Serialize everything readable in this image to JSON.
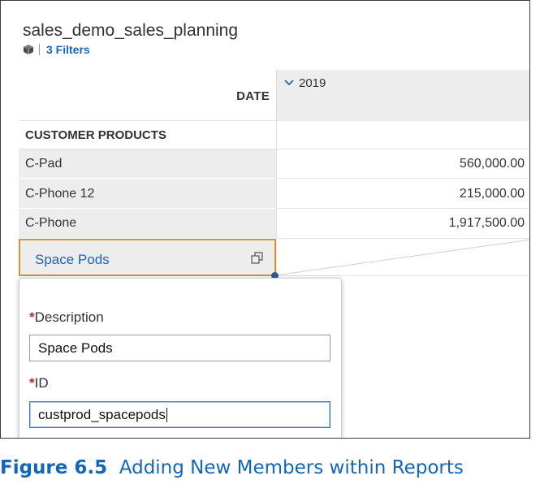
{
  "app": {
    "title": "sales_demo_sales_planning",
    "filters_label": "3 Filters",
    "filter_icon": "cube-icon"
  },
  "table": {
    "row_dimension_header": "DATE",
    "column_header": "2019",
    "column_header_icon": "chevron-down-icon",
    "section_header": "CUSTOMER PRODUCTS",
    "rows": [
      {
        "label": "C-Pad",
        "value": "560,000.00"
      },
      {
        "label": "C-Phone 12",
        "value": "215,000.00"
      },
      {
        "label": "C-Phone",
        "value": "1,917,500.00"
      }
    ],
    "new_member_label": "Space Pods",
    "new_member_icon": "open-external-icon"
  },
  "popup": {
    "required_marker": "*",
    "description_label": "Description",
    "description_value": "Space Pods",
    "id_label": "ID",
    "id_value": "custprod_spacepods"
  },
  "caption": {
    "figure": "Figure 6.5",
    "text": "Adding New Members within Reports"
  },
  "colors": {
    "accent_blue": "#1f63b5",
    "edit_border": "#d8952e",
    "required_red": "#b32c2c",
    "caption_blue": "#1466b8"
  }
}
